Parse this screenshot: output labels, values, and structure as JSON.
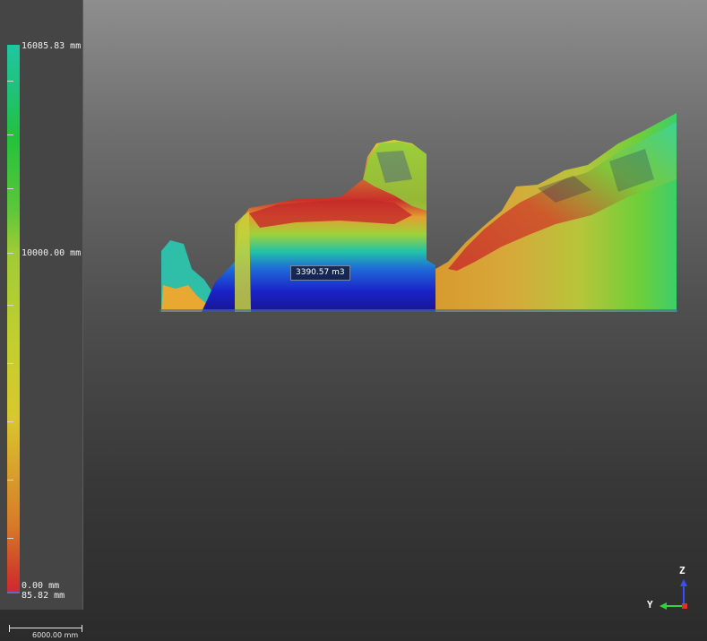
{
  "color_scale": {
    "max_label": "16085.83 mm",
    "mid_label": "10000.00 mm",
    "zero_label": "0.00 mm",
    "min_label": "85.82 mm"
  },
  "volume_label": "3390.57 m3",
  "ruler_label": "6000.00 mm",
  "axes": {
    "z": "Z",
    "y": "Y"
  },
  "icons": {
    "axis": "axis-gizmo-icon"
  }
}
